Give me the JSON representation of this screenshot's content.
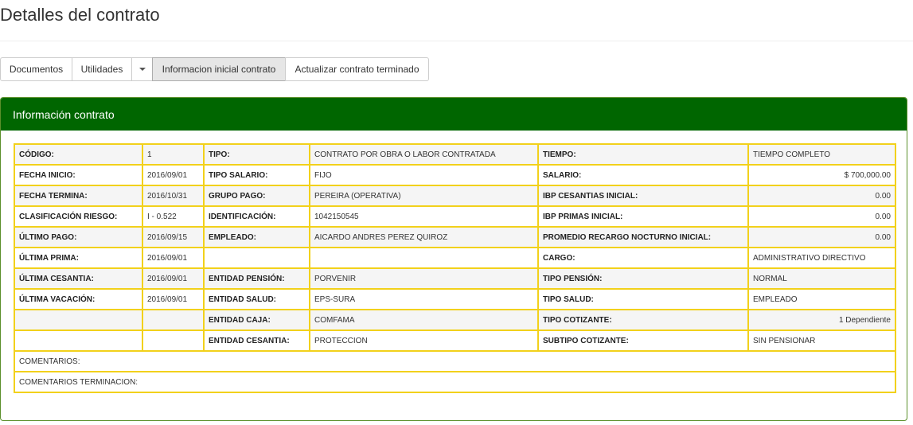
{
  "page": {
    "title": "Detalles del contrato"
  },
  "toolbar": {
    "documentos": "Documentos",
    "utilidades": "Utilidades",
    "informacion_inicial": "Informacion inicial contrato",
    "actualizar": "Actualizar contrato terminado"
  },
  "panel": {
    "title": "Información contrato"
  },
  "rows": [
    {
      "c1": "CÓDIGO:",
      "v1": "1",
      "c2": "TIPO:",
      "v2": "CONTRATO POR OBRA O LABOR CONTRATADA",
      "c3": "TIEMPO:",
      "v3": "TIEMPO COMPLETO"
    },
    {
      "c1": "FECHA INICIO:",
      "v1": "2016/09/01",
      "c2": "TIPO SALARIO:",
      "v2": "FIJO",
      "c3": "SALARIO:",
      "v3": "$ 700,000.00"
    },
    {
      "c1": "FECHA TERMINA:",
      "v1": "2016/10/31",
      "c2": "GRUPO PAGO:",
      "v2": "PEREIRA (OPERATIVA)",
      "c3": "IBP CESANTIAS INICIAL:",
      "v3": "0.00"
    },
    {
      "c1": "CLASIFICACIÓN RIESGO:",
      "v1": "I - 0.522",
      "c2": "IDENTIFICACIÓN:",
      "v2": "1042150545",
      "c3": "IBP PRIMAS INICIAL:",
      "v3": "0.00"
    },
    {
      "c1": "ÚLTIMO PAGO:",
      "v1": "2016/09/15",
      "c2": "EMPLEADO:",
      "v2": "AICARDO ANDRES PEREZ QUIROZ",
      "c3": "PROMEDIO RECARGO NOCTURNO INICIAL:",
      "v3": "0.00"
    },
    {
      "c1": "ÚLTIMA PRIMA:",
      "v1": "2016/09/01",
      "c2": "",
      "v2": "",
      "c3": "CARGO:",
      "v3": "ADMINISTRATIVO DIRECTIVO"
    },
    {
      "c1": "ÚLTIMA CESANTIA:",
      "v1": "2016/09/01",
      "c2": "ENTIDAD PENSIÓN:",
      "v2": "PORVENIR",
      "c3": "TIPO PENSIÓN:",
      "v3": "NORMAL"
    },
    {
      "c1": "ÚLTIMA VACACIÓN:",
      "v1": "2016/09/01",
      "c2": "ENTIDAD SALUD:",
      "v2": "EPS-SURA",
      "c3": "TIPO SALUD:",
      "v3": "EMPLEADO"
    },
    {
      "c1": "",
      "v1": "",
      "c2": "ENTIDAD CAJA:",
      "v2": "COMFAMA",
      "c3": "TIPO COTIZANTE:",
      "v3": "1 Dependiente"
    },
    {
      "c1": "",
      "v1": "",
      "c2": "ENTIDAD CESANTIA:",
      "v2": "PROTECCION",
      "c3": "SUBTIPO COTIZANTE:",
      "v3": "SIN PENSIONAR"
    }
  ],
  "comments": {
    "comentarios": "COMENTARIOS:",
    "comentarios_terminacion": "COMENTARIOS TERMINACION:"
  },
  "colors": {
    "panel_header": "#006600",
    "table_border": "#f2d11b"
  },
  "icons": {
    "dropdown": "caret-down-icon"
  }
}
